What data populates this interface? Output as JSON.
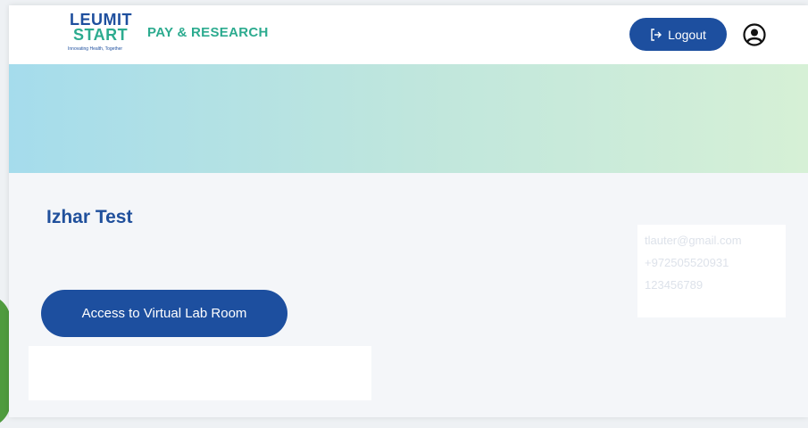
{
  "logo": {
    "line1": "LEUMIT",
    "line2": "START",
    "tagline": "Innovating Health, Together"
  },
  "header": {
    "app_title": "PAY & RESEARCH",
    "logout_label": "Logout",
    "logout_icon": "logout-arrow-icon",
    "profile_icon": "user-circle-icon"
  },
  "profile": {
    "name": "Izhar Test",
    "email": "tlauter@gmail.com",
    "phone": "+972505520931",
    "id_number": "123456789"
  },
  "actions": {
    "virtual_lab_label": "Access to Virtual Lab Room"
  },
  "colors": {
    "primary": "#1d4f9f",
    "accent_green": "#2cab8f",
    "banner_start": "#a5dcec",
    "banner_end": "#d6f0d6"
  }
}
